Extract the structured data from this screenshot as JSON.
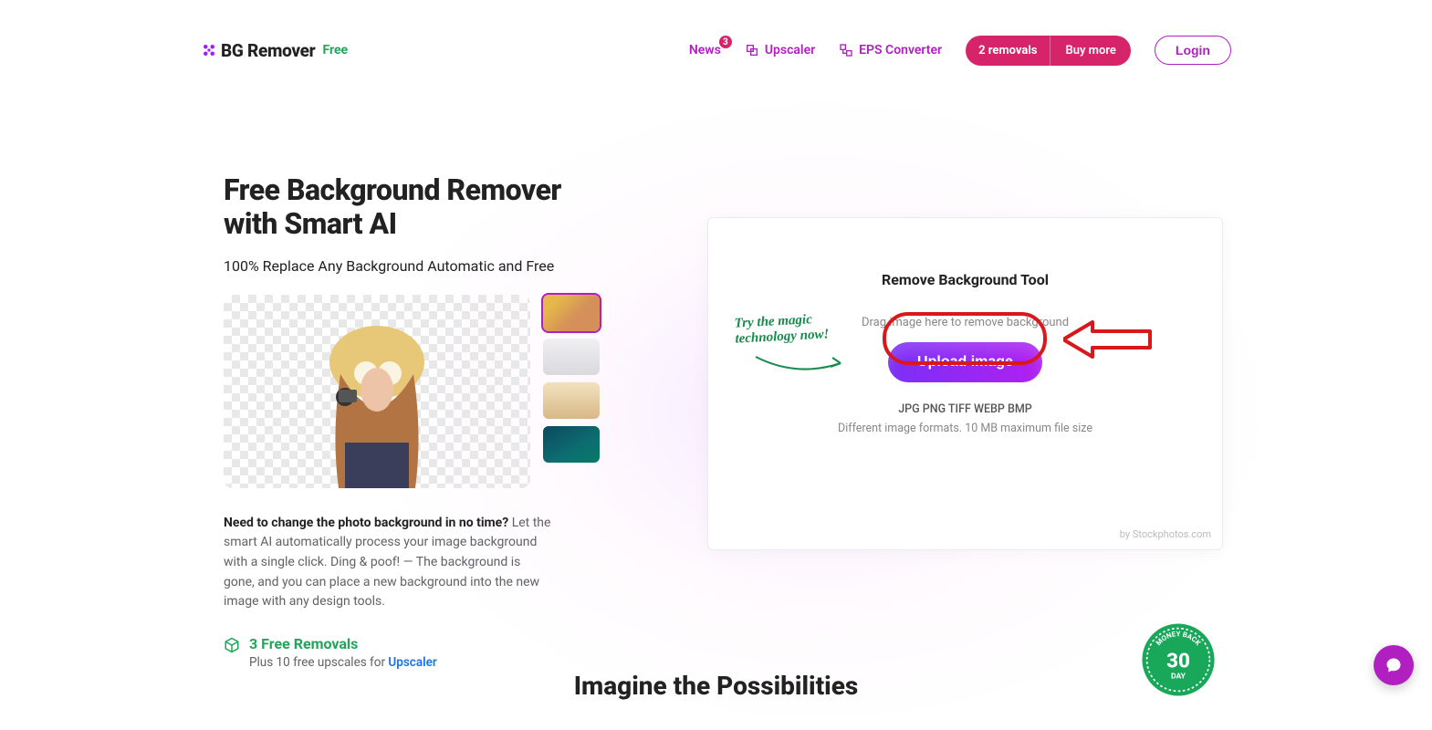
{
  "brand": {
    "name": "BG Remover",
    "tag": "Free"
  },
  "nav": {
    "news": "News",
    "news_badge": "3",
    "upscaler": "Upscaler",
    "eps": "EPS Converter"
  },
  "pill": {
    "left": "2 removals",
    "right": "Buy more"
  },
  "login": "Login",
  "hero": {
    "title_l1": "Free Background Remover",
    "title_l2": "with Smart AI",
    "subtitle": "100% Replace Any Background Automatic and Free",
    "desc_strong": "Need to change the photo background in no time?",
    "desc_rest": " Let the smart AI automatically process your image background with a single click. Ding & poof! — The background is gone, and you can place a new background into the new image with any design tools."
  },
  "free": {
    "title": "3 Free Removals",
    "sub_prefix": "Plus 10 free upscales for ",
    "sub_link": "Upscaler"
  },
  "card": {
    "title": "Remove Background Tool",
    "hint": "Drag image here to remove background",
    "button": "Upload image",
    "formats": "JPG PNG TIFF WEBP BMP",
    "size": "Different image formats. 10 MB maximum file size",
    "byline": "by Stockphotos.com"
  },
  "handwriting_l1": "Try the magic",
  "handwriting_l2": "technology now!",
  "bottom_heading": "Imagine the Possibilities",
  "badge": {
    "top": "MONEY BACK",
    "num": "30",
    "day": "DAY"
  }
}
